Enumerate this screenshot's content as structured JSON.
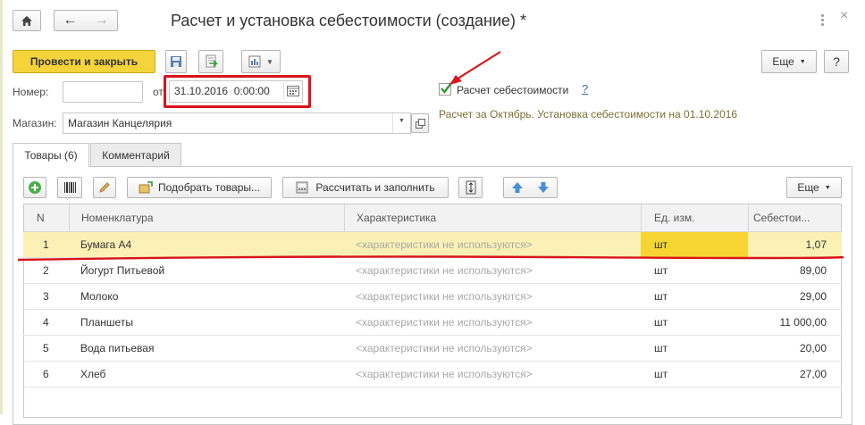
{
  "window": {
    "title": "Расчет и установка себестоимости (создание) *"
  },
  "toolbar": {
    "post_close_label": "Провести и закрыть",
    "more_label": "Еще",
    "help_label": "?"
  },
  "form": {
    "number_label": "Номер:",
    "number_value": "",
    "date_from_label": "от",
    "date_value": "31.10.2016  0:00:00",
    "cost_calc_label": "Расчет себестоимости",
    "cost_calc_help": "?",
    "cost_calc_checked": true,
    "info_text": "Расчет за Октябрь. Установка себестоимости на 01.10.2016",
    "store_label": "Магазин:",
    "store_value": "Магазин Канцелярия"
  },
  "tabs": [
    {
      "label": "Товары (6)",
      "active": true
    },
    {
      "label": "Комментарий",
      "active": false
    }
  ],
  "table_toolbar": {
    "pick_goods_label": "Подобрать товары...",
    "calc_fill_label": "Рассчитать и заполнить",
    "more_label": "Еще"
  },
  "table": {
    "columns": [
      "N",
      "Номенклатура",
      "Характеристика",
      "Ед. изм.",
      "Себестои..."
    ],
    "rows": [
      {
        "n": "1",
        "item": "Бумага А4",
        "char": "<характеристики не используются>",
        "unit": "шт",
        "cost": "1,07"
      },
      {
        "n": "2",
        "item": "Йогурт Питьевой",
        "char": "<характеристики не используются>",
        "unit": "шт",
        "cost": "89,00"
      },
      {
        "n": "3",
        "item": "Молоко",
        "char": "<характеристики не используются>",
        "unit": "шт",
        "cost": "29,00"
      },
      {
        "n": "4",
        "item": "Планшеты",
        "char": "<характеристики не используются>",
        "unit": "шт",
        "cost": "11 000,00"
      },
      {
        "n": "5",
        "item": "Вода питьевая",
        "char": "<характеристики не используются>",
        "unit": "шт",
        "cost": "20,00"
      },
      {
        "n": "6",
        "item": "Хлеб",
        "char": "<характеристики не используются>",
        "unit": "шт",
        "cost": "27,00"
      }
    ]
  },
  "colors": {
    "accent_yellow": "#f5d33b",
    "selected_row": "#fbf1b4",
    "selected_cell": "#f6d533",
    "annotation_red": "#d9141c",
    "info_text_color": "#7b6f33"
  }
}
